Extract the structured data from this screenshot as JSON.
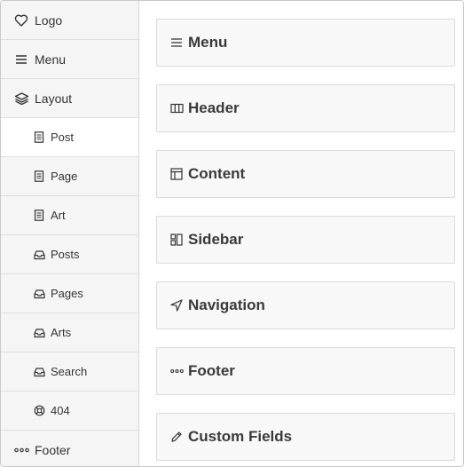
{
  "sidebar": {
    "items": [
      {
        "label": "Logo",
        "icon": "heart-icon"
      },
      {
        "label": "Menu",
        "icon": "menu-icon"
      },
      {
        "label": "Layout",
        "icon": "layers-icon"
      },
      {
        "label": "Post",
        "icon": "document-icon",
        "active": true
      },
      {
        "label": "Page",
        "icon": "document-icon"
      },
      {
        "label": "Art",
        "icon": "document-icon"
      },
      {
        "label": "Posts",
        "icon": "inbox-icon"
      },
      {
        "label": "Pages",
        "icon": "inbox-icon"
      },
      {
        "label": "Arts",
        "icon": "inbox-icon"
      },
      {
        "label": "Search",
        "icon": "inbox-icon"
      },
      {
        "label": "404",
        "icon": "lifebuoy-icon"
      },
      {
        "label": "Footer",
        "icon": "more-dots-icon"
      }
    ]
  },
  "main": {
    "cards": [
      {
        "title": "Menu",
        "icon": "menu-icon"
      },
      {
        "title": "Header",
        "icon": "columns-icon"
      },
      {
        "title": "Content",
        "icon": "layout-icon"
      },
      {
        "title": "Sidebar",
        "icon": "sidebar-blocks-icon"
      },
      {
        "title": "Navigation",
        "icon": "navigation-arrow-icon"
      },
      {
        "title": "Footer",
        "icon": "more-dots-icon"
      },
      {
        "title": "Custom Fields",
        "icon": "pencil-icon"
      }
    ]
  },
  "colors": {
    "sidebar_bg": "#f5f5f5",
    "active_bg": "#ffffff",
    "card_bg": "#f8f8f8",
    "border": "#dadada",
    "text": "#333333"
  }
}
